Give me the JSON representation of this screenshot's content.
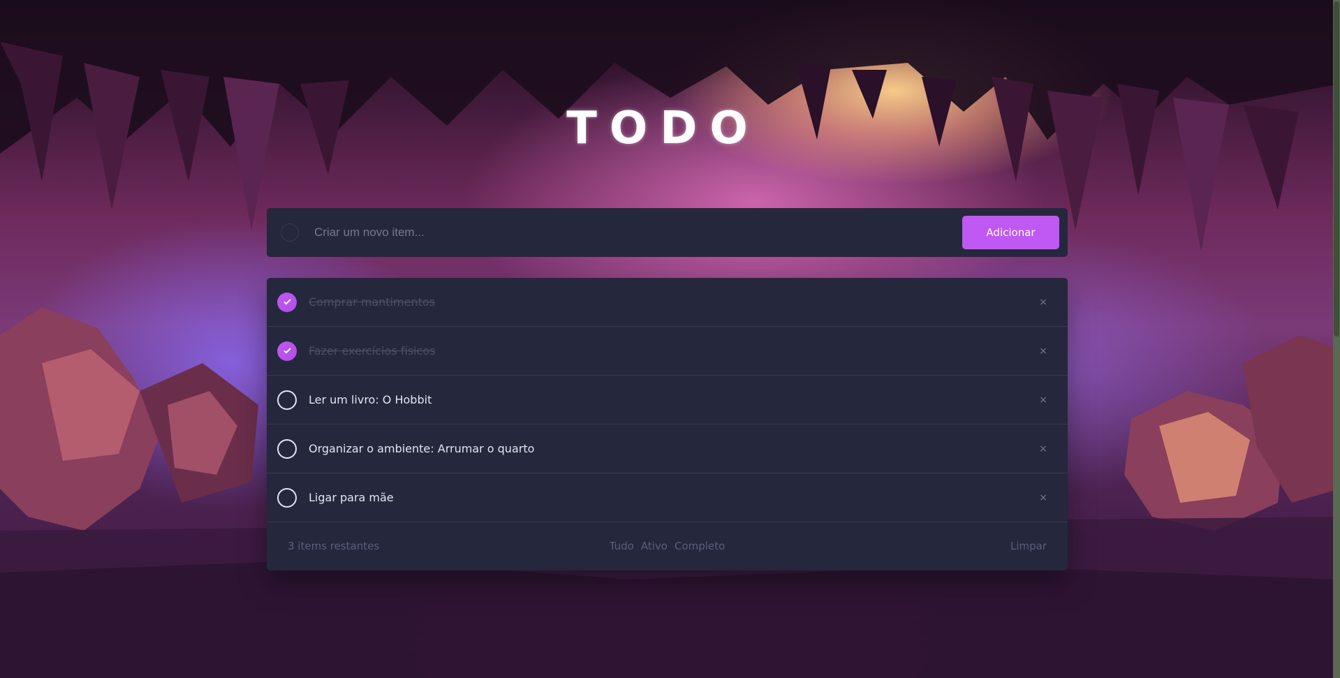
{
  "app": {
    "title": "TODO"
  },
  "new_item": {
    "placeholder": "Criar um novo item...",
    "add_label": "Adicionar"
  },
  "todos": [
    {
      "text": "Comprar mantimentos",
      "completed": true
    },
    {
      "text": "Fazer exercícios físicos",
      "completed": true
    },
    {
      "text": "Ler um livro: O Hobbit",
      "completed": false
    },
    {
      "text": "Organizar o ambiente: Arrumar o quarto",
      "completed": false
    },
    {
      "text": "Ligar para mãe",
      "completed": false
    }
  ],
  "footer": {
    "remaining": "3 items restantes",
    "filters": [
      "Tudo",
      "Ativo",
      "Completo"
    ],
    "clear_label": "Limpar"
  },
  "icons": {
    "check": "check-icon",
    "delete": "close-icon",
    "delete_glyph": "×"
  },
  "colors": {
    "accent": "#c058f3",
    "card": "#25273c",
    "text": "#e4e5f1",
    "muted": "#5b5e7e",
    "completed_text": "#4d5067"
  }
}
